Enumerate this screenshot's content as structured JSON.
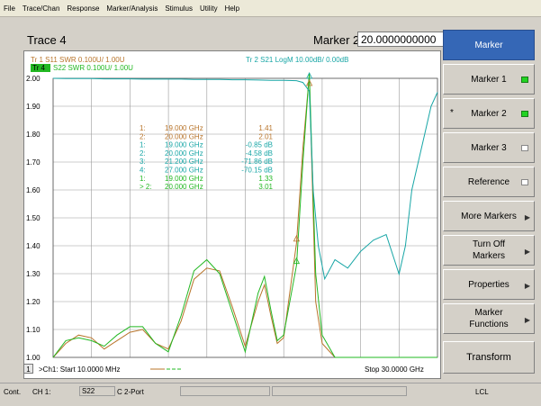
{
  "menu": [
    "File",
    "Trace/Chan",
    "Response",
    "Marker/Analysis",
    "Stimulus",
    "Utility",
    "Help"
  ],
  "trace_title": "Trace 4",
  "marker_header": "Marker 2",
  "marker_value": "20.0000000000 GHz",
  "trace_labels": {
    "tr1": "Tr  1  S11 SWR 0.100U/  1.00U",
    "tr4_tag": "Tr  4",
    "tr4": "S22 SWR 0.100U/  1.00U",
    "tr2": "Tr  2  S21 LogM 10.00dB/  0.00dB"
  },
  "y_ticks": [
    "2.00",
    "1.90",
    "1.80",
    "1.70",
    "1.60",
    "1.50",
    "1.40",
    "1.30",
    "1.20",
    "1.10",
    "1.00"
  ],
  "marker_table": [
    {
      "id": "1:",
      "freq": "19.000 GHz",
      "value": "1.41",
      "color": "#b8742a"
    },
    {
      "id": "2:",
      "freq": "20.000 GHz",
      "value": "2.01",
      "color": "#b8742a"
    },
    {
      "id": "1:",
      "freq": "19.000 GHz",
      "value": "-0.85 dB",
      "color": "#18a6a6"
    },
    {
      "id": "2:",
      "freq": "20.000 GHz",
      "value": "-4.58 dB",
      "color": "#18a6a6"
    },
    {
      "id": "3:",
      "freq": "21.200 GHz",
      "value": "-71.86 dB",
      "color": "#18a6a6"
    },
    {
      "id": "4:",
      "freq": "27.000 GHz",
      "value": "-70.15 dB",
      "color": "#18a6a6"
    },
    {
      "id": "1:",
      "freq": "19.000 GHz",
      "value": "1.33",
      "color": "#22b822"
    },
    {
      "id": "> 2:",
      "freq": "20.000 GHz",
      "value": "3.01",
      "color": "#22b822"
    }
  ],
  "plot_footer": {
    "channel_num": "1",
    "start": ">Ch1: Start  10.0000 MHz",
    "stop": "Stop  30.0000 GHz"
  },
  "right_buttons": [
    {
      "label": "Marker",
      "type": "header"
    },
    {
      "label": "Marker 1",
      "indicator": "on"
    },
    {
      "label": "Marker 2",
      "indicator": "on",
      "active": true
    },
    {
      "label": "Marker 3",
      "indicator": "off"
    },
    {
      "label": "Reference",
      "indicator": "off"
    },
    {
      "label": "More Markers",
      "arrow": true
    },
    {
      "label": "Turn Off Markers",
      "arrow": true
    },
    {
      "label": "Properties",
      "arrow": true
    },
    {
      "label": "Marker Functions",
      "arrow": true
    },
    {
      "label": "Transform"
    }
  ],
  "status": {
    "mode": "Cont.",
    "channel": "CH 1:",
    "param": "S22",
    "cal": "C  2-Port",
    "lcl": "LCL"
  },
  "colors": {
    "s11": "#b8742a",
    "s21": "#18a6a6",
    "s22": "#22b822",
    "header": "#3567b6"
  },
  "chart_data": {
    "type": "line",
    "x_range_ghz": [
      0.01,
      30
    ],
    "ylim": [
      1.0,
      2.0
    ],
    "grid": true,
    "series": [
      {
        "name": "S11 SWR",
        "x": [
          0.01,
          1,
          2,
          3,
          4,
          5,
          6,
          7,
          8,
          9,
          10,
          11,
          12,
          13,
          14,
          15,
          16,
          16.5,
          17,
          17.5,
          18,
          19,
          19.5,
          20,
          20.5,
          21,
          22,
          23,
          24,
          25,
          26,
          27,
          28,
          29,
          30
        ],
        "y": [
          1.0,
          1.05,
          1.08,
          1.07,
          1.03,
          1.06,
          1.09,
          1.1,
          1.05,
          1.03,
          1.13,
          1.28,
          1.32,
          1.31,
          1.18,
          1.04,
          1.2,
          1.26,
          1.15,
          1.05,
          1.07,
          1.41,
          1.75,
          2.01,
          1.2,
          1.05,
          1.0,
          1.0,
          1.0,
          1.0,
          1.0,
          1.0,
          1.0,
          1.0,
          1.0
        ]
      },
      {
        "name": "S22 SWR",
        "x": [
          0.01,
          1,
          2,
          3,
          4,
          5,
          6,
          7,
          8,
          9,
          10,
          11,
          12,
          13,
          14,
          15,
          16,
          16.5,
          17,
          17.5,
          18,
          19,
          19.5,
          20,
          20.5,
          21,
          22,
          23,
          24,
          25,
          26,
          27,
          28,
          29,
          30
        ],
        "y": [
          1.0,
          1.06,
          1.07,
          1.06,
          1.04,
          1.08,
          1.11,
          1.11,
          1.05,
          1.02,
          1.15,
          1.31,
          1.35,
          1.3,
          1.16,
          1.02,
          1.23,
          1.29,
          1.17,
          1.06,
          1.08,
          1.33,
          1.7,
          2.08,
          1.3,
          1.08,
          1.0,
          1.0,
          1.0,
          1.0,
          1.0,
          1.0,
          1.0,
          1.0,
          1.0
        ]
      },
      {
        "name": "S21 LogM",
        "x": [
          0.01,
          1,
          2,
          3,
          4,
          5,
          6,
          7,
          8,
          9,
          10,
          11,
          12,
          13,
          14,
          15,
          16,
          17,
          18,
          19,
          19.5,
          20,
          20.3,
          20.7,
          21.2,
          22,
          23,
          24,
          25,
          26,
          27,
          27.5,
          28,
          29,
          29.5,
          30
        ],
        "y_db": [
          0,
          -0.1,
          -0.1,
          -0.1,
          -0.2,
          -0.2,
          -0.2,
          -0.3,
          -0.3,
          -0.3,
          -0.3,
          -0.4,
          -0.4,
          -0.4,
          -0.5,
          -0.5,
          -0.6,
          -0.7,
          -0.7,
          -0.85,
          -1.5,
          -4.58,
          -40,
          -60,
          -71.86,
          -65,
          -68,
          -62,
          -58,
          -56,
          -70.15,
          -60,
          -40,
          -20,
          -10,
          -5
        ]
      }
    ]
  }
}
